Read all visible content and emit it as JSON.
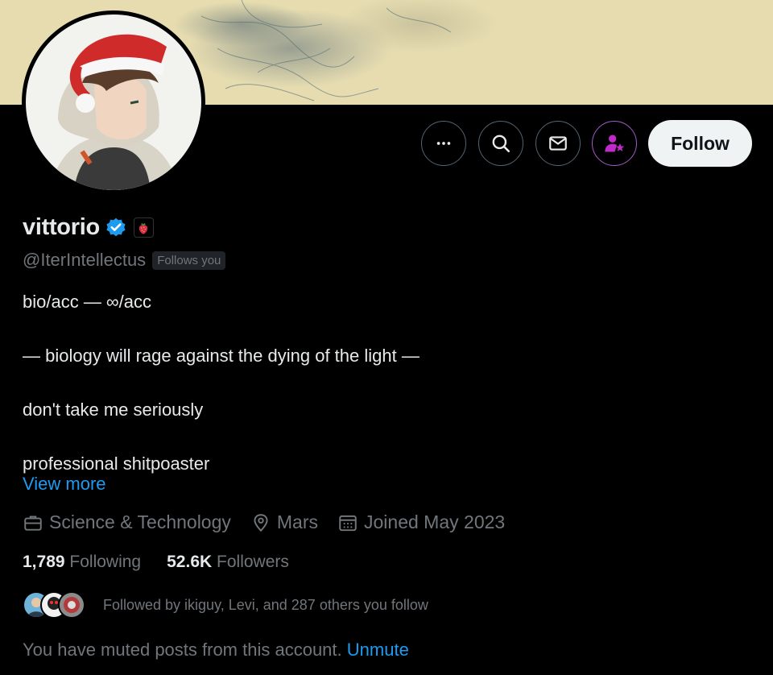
{
  "profile": {
    "name": "vittorio",
    "handle": "@IterIntellectus",
    "follows_you_badge": "Follows you",
    "verified_icon": "verified-badge-icon",
    "affiliation_icon": "strawberry-icon",
    "bio": [
      "bio/acc  — ∞/acc",
      "— biology will rage against the dying of the light —",
      "don't take me seriously",
      "professional shitpoaster"
    ],
    "view_more": "View more",
    "category": "Science & Technology",
    "location": "Mars",
    "joined": "Joined May 2023",
    "following_count": "1,789",
    "following_label": "Following",
    "followers_count": "52.6K",
    "followers_label": "Followers",
    "followed_by": "Followed by ikiguy, Levi, and 287 others you follow",
    "muted_text": "You have muted posts from this account.",
    "unmute_label": "Unmute"
  },
  "actions": {
    "more_icon": "more-dots-icon",
    "search_icon": "search-icon",
    "message_icon": "envelope-icon",
    "subscribe_icon": "subscribe-person-star-icon",
    "follow_label": "Follow"
  },
  "colors": {
    "background": "#000000",
    "text_primary": "#e7e9ea",
    "text_secondary": "#71767b",
    "link": "#1d9bf0",
    "verified": "#1d9bf0",
    "subscribe_accent": "#c02ac9",
    "follow_button_bg": "#eff3f4",
    "banner": "#e6dcb0"
  }
}
